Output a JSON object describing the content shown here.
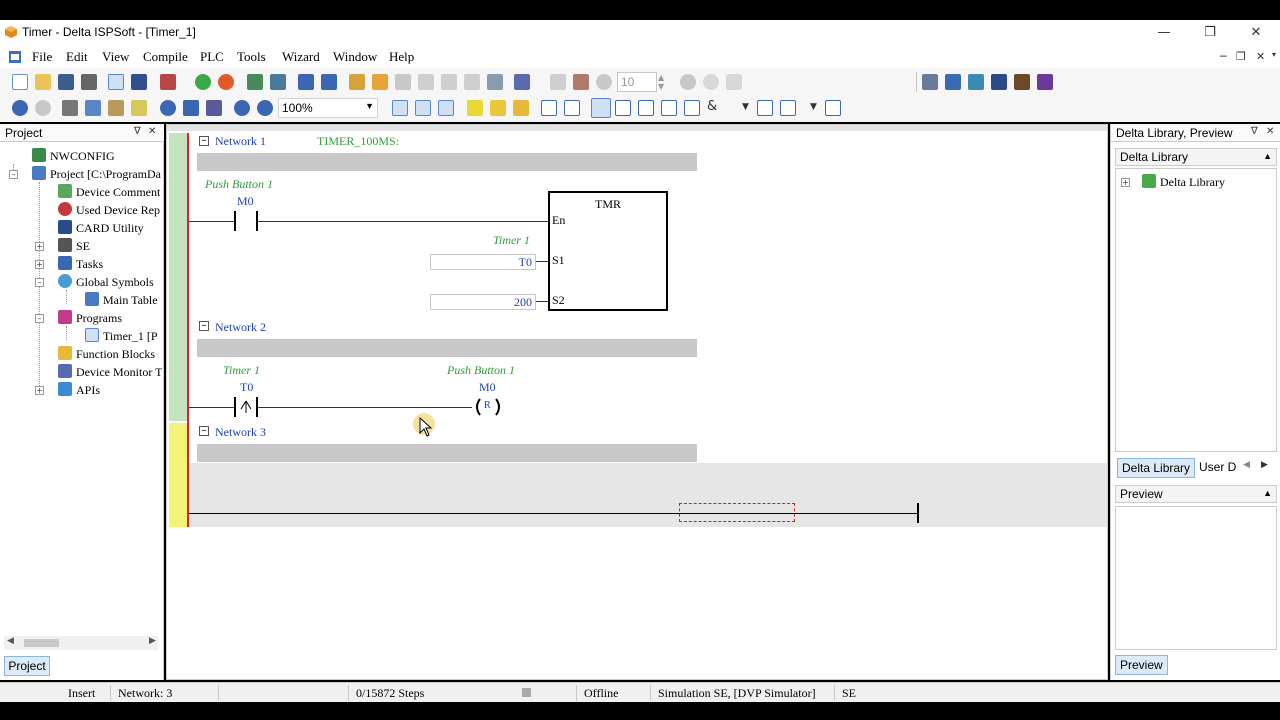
{
  "window": {
    "title": "Timer - Delta ISPSoft - [Timer_1]"
  },
  "menu": [
    "File",
    "Edit",
    "View",
    "Compile",
    "PLC",
    "Tools",
    "Wizard",
    "Window",
    "Help"
  ],
  "toolbar": {
    "zoom": "100%",
    "step_value": "10"
  },
  "project_panel": {
    "title": "Project",
    "tree": [
      {
        "label": "NWCONFIG",
        "icon": "network-config-icon"
      },
      {
        "label": "Project [C:\\ProgramDa",
        "icon": "project-icon"
      },
      {
        "label": "Device Comment",
        "icon": "device-comment-icon"
      },
      {
        "label": "Used Device Rep",
        "icon": "used-device-icon"
      },
      {
        "label": "CARD Utility",
        "icon": "card-utility-icon"
      },
      {
        "label": "SE",
        "icon": "se-icon"
      },
      {
        "label": "Tasks",
        "icon": "tasks-icon"
      },
      {
        "label": "Global Symbols",
        "icon": "global-symbols-icon"
      },
      {
        "label": "Main Table",
        "icon": "table-icon"
      },
      {
        "label": "Programs",
        "icon": "programs-icon"
      },
      {
        "label": "Timer_1 [P",
        "icon": "program-file-icon"
      },
      {
        "label": "Function Blocks",
        "icon": "function-blocks-icon"
      },
      {
        "label": "Device Monitor T",
        "icon": "device-monitor-icon"
      },
      {
        "label": "APIs",
        "icon": "apis-icon"
      }
    ],
    "bottom_tab": "Project"
  },
  "editor": {
    "network1": {
      "label": "Network 1",
      "comment": "TIMER_100MS:",
      "contact_comment": "Push Button 1",
      "contact_device": "M0",
      "block_name": "TMR",
      "pin_en": "En",
      "pin_s1": "S1",
      "pin_s2": "S2",
      "s1_comment": "Timer 1",
      "s1_value": "T0",
      "s2_value": "200"
    },
    "network2": {
      "label": "Network 2",
      "contact_comment": "Timer 1",
      "contact_device": "T0",
      "coil_comment": "Push Button 1",
      "coil_device": "M0",
      "coil_type": "R"
    },
    "network3": {
      "label": "Network 3"
    }
  },
  "library_panel": {
    "title": "Delta Library, Preview",
    "section": "Delta Library",
    "tree_item": "Delta Library",
    "tabs": [
      "Delta Library",
      "User D"
    ],
    "preview_title": "Preview",
    "preview_tab": "Preview"
  },
  "status": {
    "mode": "Insert",
    "network": "Network: 3",
    "steps": "0/15872 Steps",
    "connection": "Offline",
    "simulation": "Simulation SE, [DVP Simulator]",
    "model": "SE"
  },
  "colors": {
    "network_label": "#1a3fb8",
    "comment": "#2e9b3a",
    "power_rail": "#dd2222",
    "gutter_green": "#c4e2bd",
    "gutter_yellow": "#f3f37a"
  }
}
